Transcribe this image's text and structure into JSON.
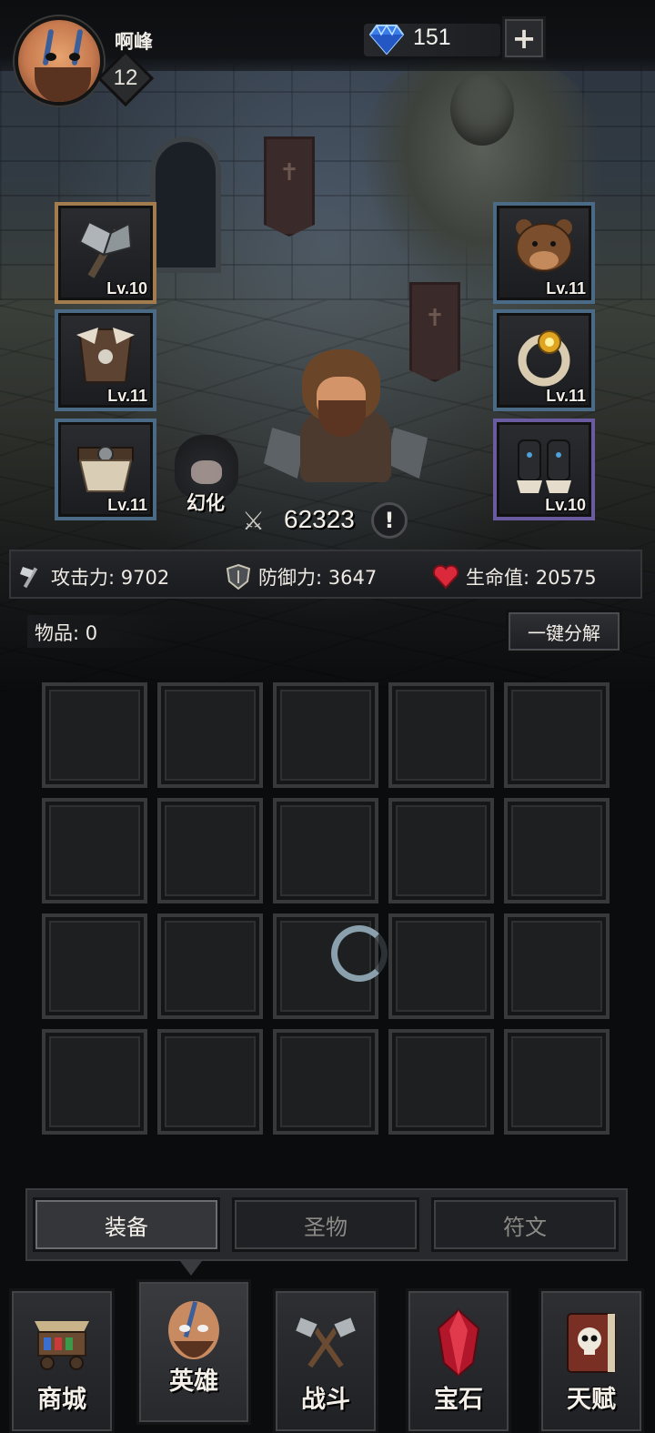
{
  "player": {
    "name": "啊峰",
    "level": "12"
  },
  "currency": {
    "gems": "151",
    "add_label": "+"
  },
  "equipment_left": [
    {
      "slot": "weapon",
      "icon": "battle-axe-icon",
      "level": "Lv.10",
      "rarity_color": "#a27b4e"
    },
    {
      "slot": "armor",
      "icon": "fur-armor-icon",
      "level": "Lv.11",
      "rarity_color": "#4a6a86"
    },
    {
      "slot": "belt",
      "icon": "fur-belt-icon",
      "level": "Lv.11",
      "rarity_color": "#4a6a86"
    }
  ],
  "equipment_right": [
    {
      "slot": "helmet",
      "icon": "bear-helmet-icon",
      "level": "Lv.11",
      "rarity_color": "#4a6a86"
    },
    {
      "slot": "ring",
      "icon": "claw-ring-icon",
      "level": "Lv.11",
      "rarity_color": "#4a6a86"
    },
    {
      "slot": "boots",
      "icon": "claw-boots-icon",
      "level": "Lv.10",
      "rarity_color": "#6a5aa0"
    }
  ],
  "hero": {
    "illusion_label": "幻化",
    "combat_power": "62323",
    "info_label": "!"
  },
  "stats": {
    "attack": "攻击力: 9702",
    "defense": "防御力: 3647",
    "health": "生命值: 20575"
  },
  "inventory": {
    "items_label": "物品: 0",
    "decompose_label": "一键分解",
    "rows": 4,
    "cols": 5
  },
  "category_tabs": [
    {
      "label": "装备",
      "active": true
    },
    {
      "label": "圣物",
      "active": false
    },
    {
      "label": "符文",
      "active": false
    }
  ],
  "bottom_nav": [
    {
      "label": "商城",
      "icon": "shop-cart-icon",
      "active": false
    },
    {
      "label": "英雄",
      "icon": "hero-portrait-icon",
      "active": true
    },
    {
      "label": "战斗",
      "icon": "crossed-axes-icon",
      "active": false
    },
    {
      "label": "宝石",
      "icon": "red-crystal-icon",
      "active": false
    },
    {
      "label": "天赋",
      "icon": "skull-book-icon",
      "active": false
    }
  ],
  "colors": {
    "rarity_blue": "#4a6a86",
    "rarity_gold": "#a27b4e",
    "rarity_purple": "#6a5aa0",
    "gem_blue": "#3a7de8",
    "health_red": "#d9293a"
  }
}
